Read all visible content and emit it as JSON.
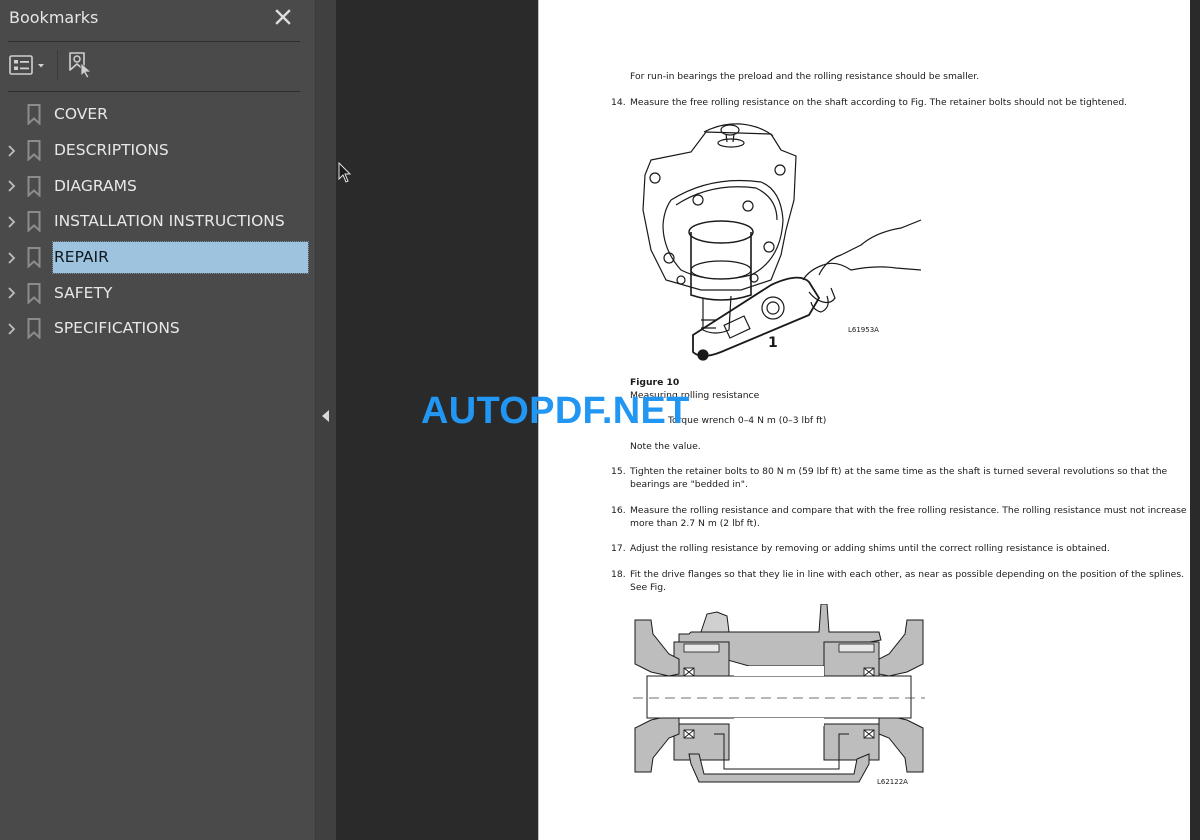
{
  "sidebar": {
    "title": "Bookmarks",
    "close_icon": "close-icon",
    "toolbar": {
      "options_icon": "list-options-icon",
      "find_icon": "find-current-bookmark-icon"
    },
    "items": [
      {
        "label": "COVER",
        "expandable": false,
        "selected": false
      },
      {
        "label": "DESCRIPTIONS",
        "expandable": true,
        "selected": false
      },
      {
        "label": "DIAGRAMS",
        "expandable": true,
        "selected": false
      },
      {
        "label": "INSTALLATION INSTRUCTIONS",
        "expandable": true,
        "selected": false
      },
      {
        "label": "REPAIR",
        "expandable": true,
        "selected": true
      },
      {
        "label": "SAFETY",
        "expandable": true,
        "selected": false
      },
      {
        "label": "SPECIFICATIONS",
        "expandable": true,
        "selected": false
      }
    ],
    "selected_color": "#9ec3de"
  },
  "document": {
    "intro_note": "For run-in bearings the preload and the rolling resistance should be smaller.",
    "steps": [
      {
        "num": "14.",
        "text": "Measure the free rolling resistance on the shaft according to Fig. The retainer bolts should not be tightened."
      },
      {
        "num": "15.",
        "lines": [
          "Tighten the retainer bolts to 80 N m (59 lbf ft) at the same time as the shaft is turned several revolutions so that the",
          "bearings are \"bedded in\"."
        ]
      },
      {
        "num": "16.",
        "lines": [
          "Measure the rolling resistance and compare that with the free rolling resistance. The rolling resistance must not increase",
          "more than 2.7 N m (2 lbf ft)."
        ]
      },
      {
        "num": "17.",
        "text": "Adjust the rolling resistance by removing or adding shims until the correct rolling resistance is obtained."
      },
      {
        "num": "18.",
        "lines": [
          "Fit the drive flanges so that they lie in line with each other, as near as possible depending on the position of the splines.",
          "See Fig."
        ]
      }
    ],
    "figure10": {
      "code": "L61953A",
      "callout": "1",
      "title": "Figure 10",
      "caption": "Measuring rolling resistance",
      "legend_num": "1.",
      "legend_text": "Torque wrench 0–4 N m (0–3 lbf ft)",
      "note": "Note the value."
    },
    "figure11": {
      "code": "L62122A"
    }
  },
  "watermark": {
    "text": "AUTOPDF.NET",
    "color": "#2196f3"
  },
  "splitter": {
    "collapse_icon": "collapse-left-arrow-icon"
  }
}
